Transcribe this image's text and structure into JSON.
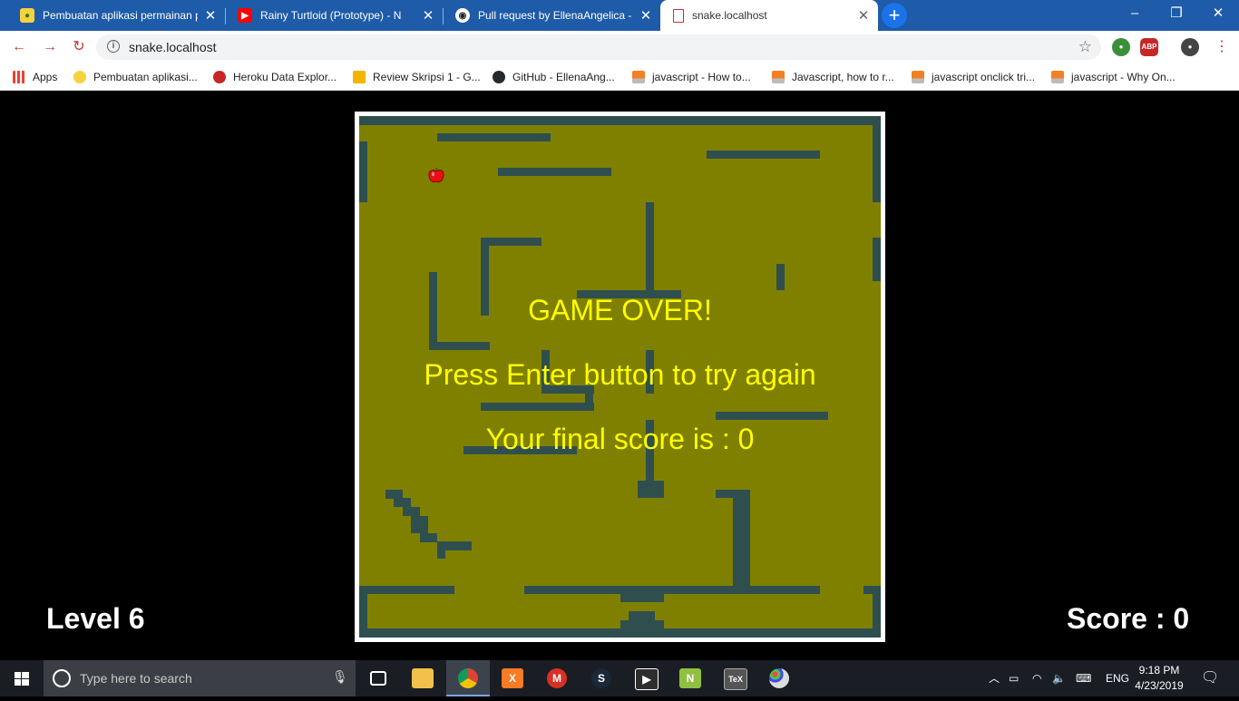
{
  "browser": {
    "tabs": [
      {
        "title": "Pembuatan aplikasi permainan p",
        "icon": "grass-shield-icon",
        "active": false
      },
      {
        "title": "Rainy Turtloid (Prototype) - N",
        "icon": "youtube-icon",
        "active": false
      },
      {
        "title": "Pull request by EllenaAngelica - P",
        "icon": "github-icon",
        "active": false
      },
      {
        "title": "snake.localhost",
        "icon": "page-icon",
        "active": true
      }
    ],
    "new_tab_label": "+",
    "window_controls": {
      "minimize": "–",
      "restore": "❐",
      "close": "✕"
    },
    "url": "snake.localhost",
    "bookmarks": [
      {
        "label": "Apps",
        "icon": "apps-grid-icon"
      },
      {
        "label": "Pembuatan aplikasi...",
        "icon": "grass-shield-icon"
      },
      {
        "label": "Heroku Data Explor...",
        "icon": "heroku-icon"
      },
      {
        "label": "Review Skripsi 1 - G...",
        "icon": "slides-icon"
      },
      {
        "label": "GitHub - EllenaAng...",
        "icon": "github-icon"
      },
      {
        "label": "javascript - How to...",
        "icon": "stackoverflow-icon"
      },
      {
        "label": "Javascript, how to r...",
        "icon": "stackoverflow-icon"
      },
      {
        "label": "javascript onclick tri...",
        "icon": "stackoverflow-icon"
      },
      {
        "label": "javascript - Why On...",
        "icon": "stackoverflow-icon"
      }
    ],
    "extensions": [
      "ABP"
    ]
  },
  "game": {
    "overlay": {
      "title": "GAME OVER!",
      "instruction": "Press Enter button to try again",
      "final_score": "Your final score is : 0"
    },
    "level_label": "Level 6",
    "score_label": "Score : 0",
    "colors": {
      "board": "#808000",
      "wall": "#2f4f4f",
      "text": "#ffff00",
      "frame": "#ffffff"
    },
    "apple_icon": "apple-icon"
  },
  "taskbar": {
    "search_placeholder": "Type here to search",
    "apps": [
      "task-view-icon",
      "file-explorer-icon",
      "chrome-icon",
      "xampp-icon",
      "gmail-icon",
      "steam-icon",
      "video-editor-icon",
      "notepad-plus-icon",
      "tex-icon",
      "paint-icon"
    ],
    "language": "ENG",
    "time": "9:18 PM",
    "date": "4/23/2019"
  }
}
